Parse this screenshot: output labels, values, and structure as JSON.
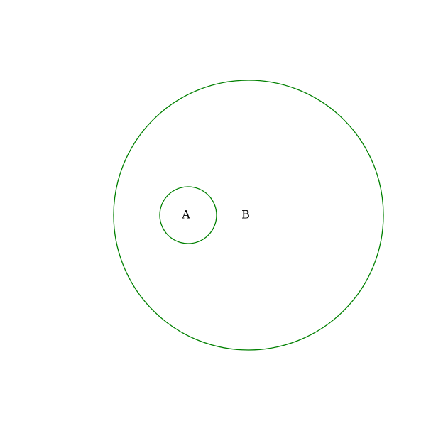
{
  "diagram": {
    "circle_color": "#008000",
    "text_color": "#000000",
    "inner_label": "A",
    "outer_label": "B"
  }
}
